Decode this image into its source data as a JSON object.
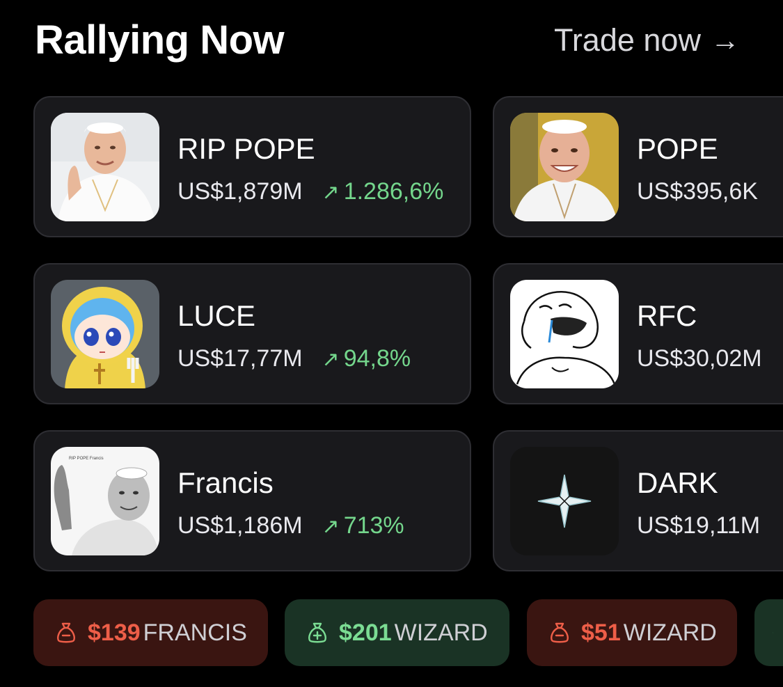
{
  "header": {
    "title": "Rallying Now",
    "trade_label": "Trade now",
    "trade_arrow": "→"
  },
  "tokens": [
    {
      "name": "RIP POPE",
      "market_cap": "US$1,879M",
      "change": "1.286,6%",
      "change_arrow": "↗"
    },
    {
      "name": "POPE",
      "market_cap": "US$395,6K"
    },
    {
      "name": "LUCE",
      "market_cap": "US$17,77M",
      "change": "94,8%",
      "change_arrow": "↗"
    },
    {
      "name": "RFC",
      "market_cap": "US$30,02M"
    },
    {
      "name": "Francis",
      "market_cap": "US$1,186M",
      "change": "713%",
      "change_arrow": "↗",
      "thumb_caption": "RIP POPE Francis"
    },
    {
      "name": "DARK",
      "market_cap": "US$19,11M"
    }
  ],
  "trades": [
    {
      "amount": "$139",
      "symbol": "FRANCIS",
      "side": "sell",
      "color": "#ee5e48"
    },
    {
      "amount": "$201",
      "symbol": "WIZARD",
      "side": "buy",
      "color": "#7bdc93"
    },
    {
      "amount": "$51",
      "symbol": "WIZARD",
      "side": "sell",
      "color": "#ee5e48"
    }
  ],
  "colors": {
    "background": "#000000",
    "card": "#19191c",
    "positive": "#74d68c",
    "negative": "#ee5e48"
  },
  "icons": [
    "arrow-right-icon",
    "trend-up-icon",
    "money-bag-minus-icon",
    "money-bag-plus-icon",
    "sparkle-icon"
  ]
}
